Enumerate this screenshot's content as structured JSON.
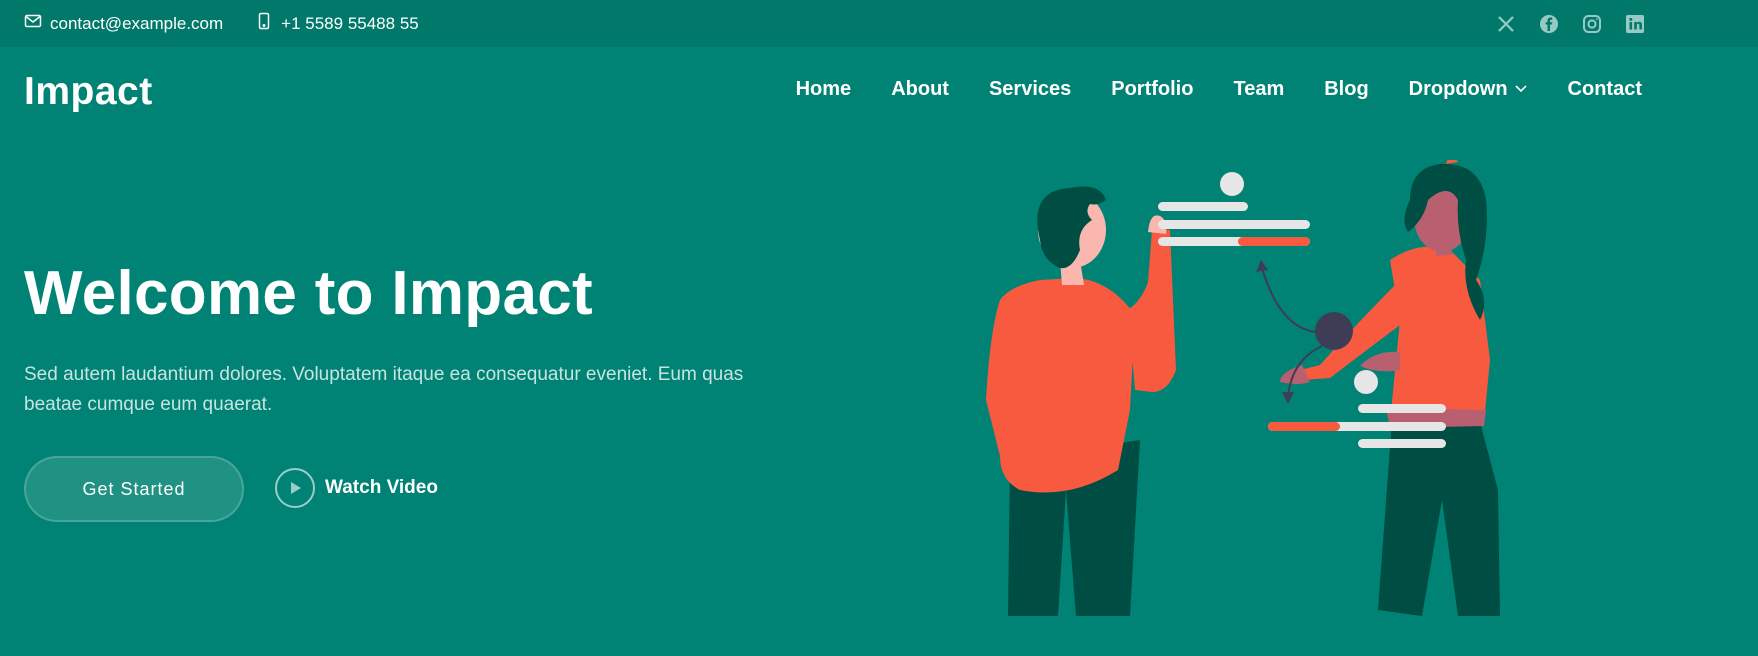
{
  "topbar": {
    "email": "contact@example.com",
    "phone": "+1 5589 55488 55",
    "email_icon": "envelope-icon",
    "phone_icon": "phone-icon",
    "socials": [
      "x-twitter-icon",
      "facebook-icon",
      "instagram-icon",
      "linkedin-icon"
    ]
  },
  "header": {
    "logo": "Impact",
    "nav": {
      "home": "Home",
      "about": "About",
      "services": "Services",
      "portfolio": "Portfolio",
      "team": "Team",
      "blog": "Blog",
      "dropdown": "Dropdown",
      "contact": "Contact"
    }
  },
  "hero": {
    "title": "Welcome to Impact",
    "subtitle": "Sed autem laudantium dolores. Voluptatem itaque ea consequatur eveniet. Eum quas beatae cumque eum quaerat.",
    "cta_primary": "Get Started",
    "cta_video": "Watch Video"
  },
  "colors": {
    "background": "#008374",
    "topbar": "#00796b",
    "accent": "#f85a40",
    "dark_green": "#004d43"
  }
}
